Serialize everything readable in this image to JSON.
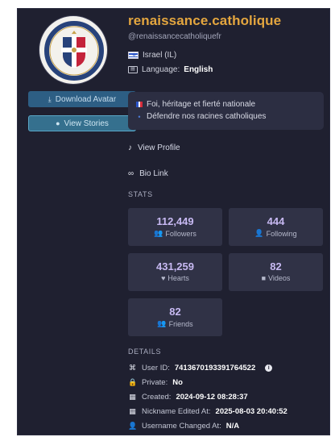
{
  "profile": {
    "name": "renaissance.catholique",
    "handle": "@renaissancecatholiquefr",
    "country": "Israel (IL)",
    "language_label": "Language:",
    "language": "English"
  },
  "actions": {
    "download": "Download Avatar",
    "stories": "View Stories"
  },
  "bio": {
    "line1": "Foi, héritage et fierté nationale",
    "line2": "Défendre nos racines catholiques"
  },
  "links": {
    "profile": "View Profile",
    "bio": "Bio Link"
  },
  "stats_title": "STATS",
  "stats": {
    "followers": {
      "value": "112,449",
      "label": "Followers"
    },
    "following": {
      "value": "444",
      "label": "Following"
    },
    "hearts": {
      "value": "431,259",
      "label": "Hearts"
    },
    "videos": {
      "value": "82",
      "label": "Videos"
    },
    "friends": {
      "value": "82",
      "label": "Friends"
    }
  },
  "details_title": "DETAILS",
  "details": {
    "user_id_label": "User ID:",
    "user_id": "7413670193391764522",
    "private_label": "Private:",
    "private": "No",
    "created_label": "Created:",
    "created": "2024-09-12 08:28:37",
    "nickname_label": "Nickname Edited At:",
    "nickname": "2025-08-03 20:40:52",
    "username_label": "Username Changed At:",
    "username": "N/A"
  },
  "colors": {
    "card_bg": "#1f2030",
    "accent_title": "#e4a63f",
    "stat_number": "#c7b9f2",
    "button_download": "#2d5e84",
    "button_stories": "#35708e"
  }
}
